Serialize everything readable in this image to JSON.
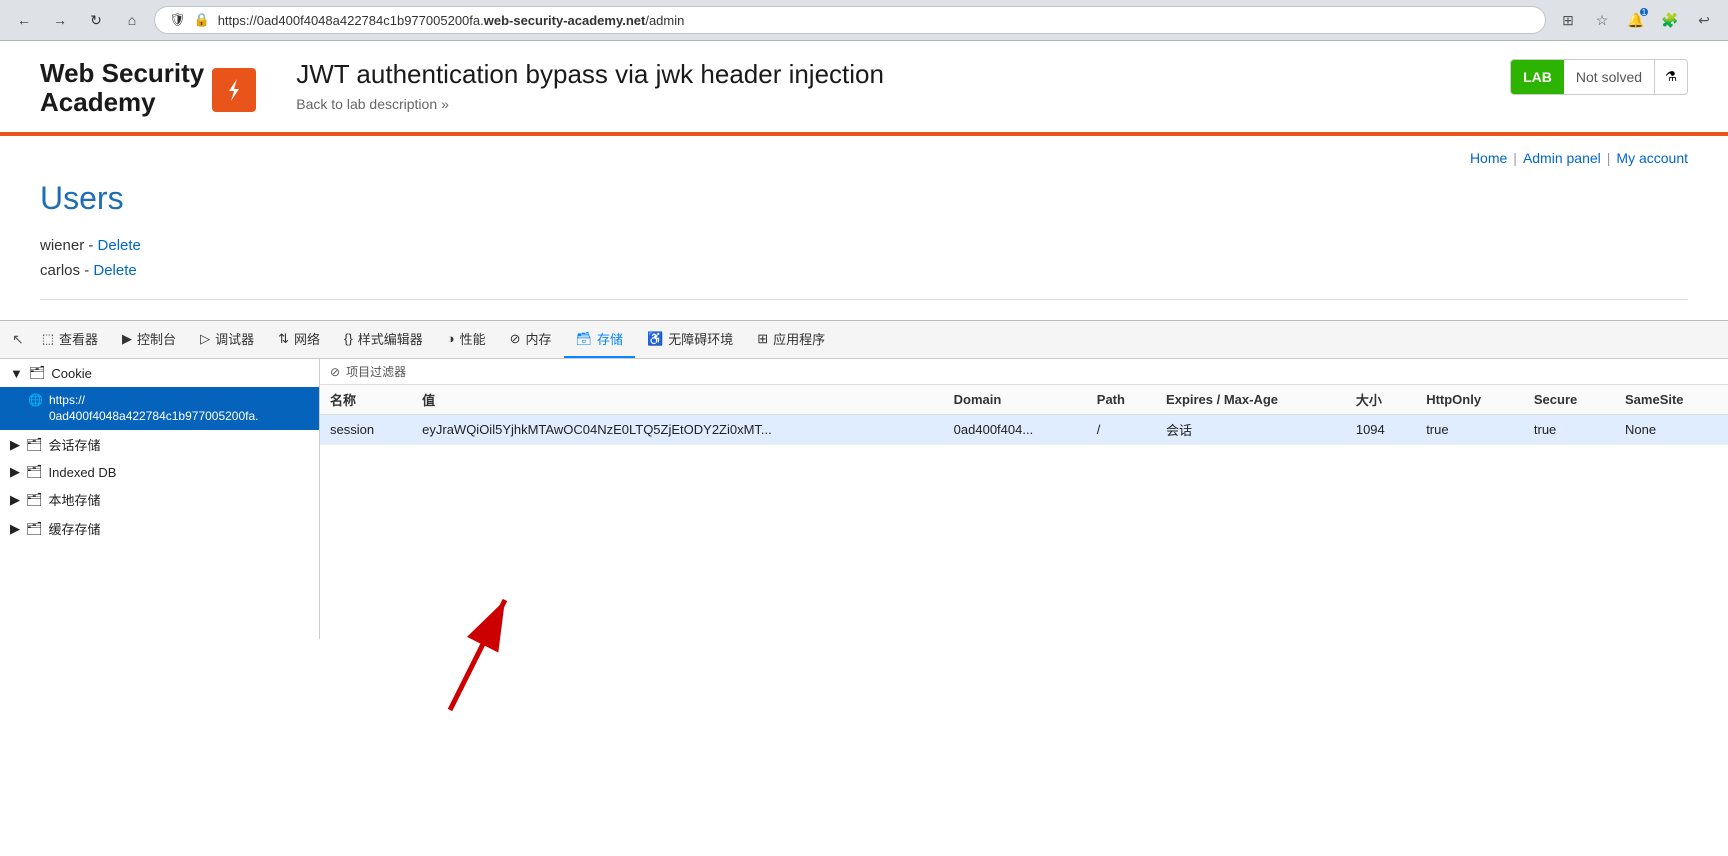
{
  "browser": {
    "url_prefix": "https://0ad400f4048a422784c1b977005200fa.",
    "url_domain": "web-security-academy.net",
    "url_path": "/admin",
    "url_full": "https://0ad400f4048a422784c1b977005200fa.web-security-academy.net/admin"
  },
  "header": {
    "logo_line1": "Web Security",
    "logo_line2": "Academy",
    "lab_title": "JWT authentication bypass via jwk header injection",
    "back_link": "Back to lab description",
    "lab_badge": "LAB",
    "lab_status": "Not solved"
  },
  "nav": {
    "home": "Home",
    "admin_panel": "Admin panel",
    "my_account": "My account",
    "sep1": "|",
    "sep2": "|"
  },
  "page": {
    "title": "Users",
    "users": [
      {
        "name": "wiener",
        "action": "Delete"
      },
      {
        "name": "carlos",
        "action": "Delete"
      }
    ]
  },
  "devtools": {
    "tabs": [
      {
        "id": "inspector",
        "label": "查看器",
        "icon": "🔲"
      },
      {
        "id": "console",
        "label": "控制台",
        "icon": "▶"
      },
      {
        "id": "debugger",
        "label": "调试器",
        "icon": "▷"
      },
      {
        "id": "network",
        "label": "网络",
        "icon": "↕"
      },
      {
        "id": "style-editor",
        "label": "样式编辑器",
        "icon": "{}"
      },
      {
        "id": "performance",
        "label": "性能",
        "icon": "◑"
      },
      {
        "id": "memory",
        "label": "内存",
        "icon": "🛇"
      },
      {
        "id": "storage",
        "label": "存储",
        "icon": "🗃",
        "active": true
      },
      {
        "id": "accessibility",
        "label": "无障碍环境",
        "icon": "♿"
      },
      {
        "id": "applications",
        "label": "应用程序",
        "icon": "⊞"
      }
    ],
    "sidebar": {
      "items": [
        {
          "id": "cookie",
          "label": "Cookie",
          "type": "group",
          "expanded": true
        },
        {
          "id": "cookie-url",
          "label": "https://\n0ad400f4048a422784c1b977005200fa.",
          "selected": true,
          "indent": 1
        },
        {
          "id": "session-storage",
          "label": "会话存储",
          "type": "group",
          "indent": 0
        },
        {
          "id": "indexed-db",
          "label": "Indexed DB",
          "type": "group",
          "indent": 0
        },
        {
          "id": "local-storage",
          "label": "本地存储",
          "type": "group",
          "indent": 0
        },
        {
          "id": "cache-storage",
          "label": "缓存存储",
          "type": "group",
          "indent": 0
        }
      ]
    },
    "filter_placeholder": "项目过滤器",
    "cookie_table": {
      "headers": [
        "名称",
        "值",
        "Domain",
        "Path",
        "Expires / Max-Age",
        "大小",
        "HttpOnly",
        "Secure",
        "SameSite"
      ],
      "rows": [
        {
          "name": "session",
          "value": "eyJraWQiOil5YjhkMTAwOC04NzE0LTQ5ZjEtODY2Zi0xMT...",
          "domain": "0ad400f404...",
          "path": "/",
          "expires": "会话",
          "size": "1094",
          "httponly": "true",
          "secure": "true",
          "samesite": "None"
        }
      ]
    }
  }
}
